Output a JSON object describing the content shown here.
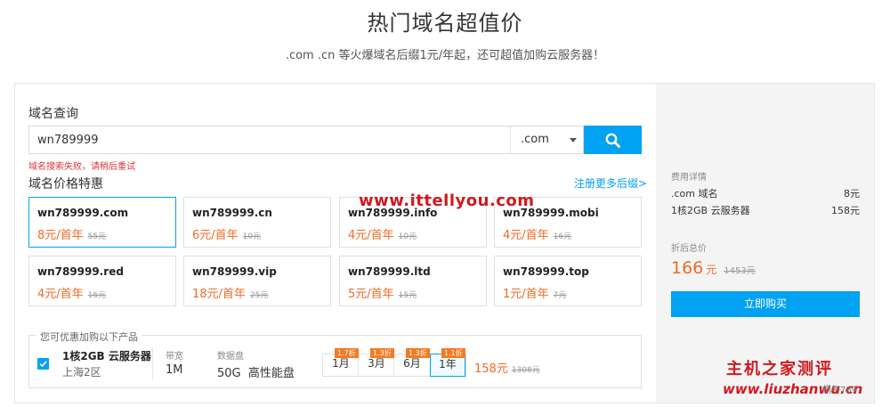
{
  "hero": {
    "title": "热门域名超值价",
    "subtitle": ".com .cn 等火爆域名后缀1元/年起，还可超值加购云服务器！"
  },
  "search": {
    "section_label": "域名查询",
    "value": "wn789999",
    "suffix": ".com",
    "error": "域名搜索失败，请稍后重试"
  },
  "pricing": {
    "section_label": "域名价格特惠",
    "more_link": "注册更多后缀>",
    "cards": [
      {
        "name": "wn789999.com",
        "price": "8元/首年",
        "old": "55元"
      },
      {
        "name": "wn789999.cn",
        "price": "6元/首年",
        "old": "10元"
      },
      {
        "name": "wn789999.info",
        "price": "4元/首年",
        "old": "10元"
      },
      {
        "name": "wn789999.mobi",
        "price": "4元/首年",
        "old": "16元"
      },
      {
        "name": "wn789999.red",
        "price": "4元/首年",
        "old": "16元"
      },
      {
        "name": "wn789999.vip",
        "price": "18元/首年",
        "old": "25元"
      },
      {
        "name": "wn789999.ltd",
        "price": "5元/首年",
        "old": "15元"
      },
      {
        "name": "wn789999.top",
        "price": "1元/首年",
        "old": "7元"
      }
    ]
  },
  "watermark": "www.ittellyou.com",
  "offer": {
    "legend": "您可优惠加购以下产品",
    "product_name": "1核2GB 云服务器",
    "region": "上海2区",
    "bandwidth_label": "带宽",
    "bandwidth_value": "1M",
    "disk_label": "数据盘",
    "disk_value": "50G  高性能盘",
    "durations": [
      {
        "label": "1月",
        "badge": "1.7折"
      },
      {
        "label": "3月",
        "badge": "1.3折"
      },
      {
        "label": "6月",
        "badge": "1.3折"
      },
      {
        "label": "1年",
        "badge": "1.1折"
      }
    ],
    "price": "158元",
    "old_price": "1308元"
  },
  "summary": {
    "details_label": "费用详情",
    "rows": [
      {
        "name": ".com 域名",
        "value": "8元"
      },
      {
        "name": "1核2GB 云服务器",
        "value": "158元"
      }
    ],
    "total_label": "折后总价",
    "total": "166",
    "total_unit": "元",
    "total_old": "1453元",
    "buy_label": "立即购买"
  },
  "stamp": {
    "title": "主机之家测评",
    "url": "www.liuzhanwu.cn",
    "corner": "蜗牛789"
  },
  "colors": {
    "accent": "#00a2f1",
    "price": "#f06b26",
    "error": "#e0353b"
  }
}
